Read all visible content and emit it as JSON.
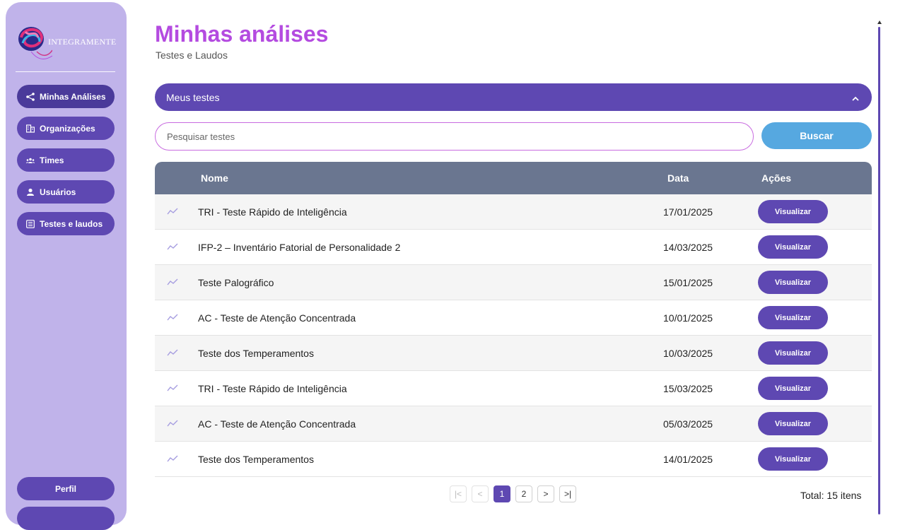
{
  "brand": {
    "logo_text": "INTEGRAMENTE"
  },
  "sidebar": {
    "items": [
      {
        "label": "Minhas Análises",
        "icon": "share-icon",
        "active": true
      },
      {
        "label": "Organizações",
        "icon": "building-icon"
      },
      {
        "label": "Times",
        "icon": "team-icon"
      },
      {
        "label": "Usuários",
        "icon": "user-icon"
      },
      {
        "label": "Testes e laudos",
        "icon": "document-list-icon"
      }
    ],
    "perfil_label": "Perfil"
  },
  "header": {
    "title": "Minhas análises",
    "subtitle": "Testes e Laudos"
  },
  "accordion": {
    "label": "Meus testes",
    "icon": "chevron-up-icon"
  },
  "search": {
    "placeholder": "Pesquisar testes",
    "value": "",
    "button_label": "Buscar"
  },
  "table": {
    "columns": [
      "Nome",
      "Data",
      "Ações"
    ],
    "rows": [
      {
        "name": "TRI - Teste Rápido de Inteligência",
        "date": "17/01/2025",
        "action": "Visualizar"
      },
      {
        "name": "IFP-2 – Inventário Fatorial de Personalidade 2",
        "date": "14/03/2025",
        "action": "Visualizar"
      },
      {
        "name": "Teste Palográfico",
        "date": "15/01/2025",
        "action": "Visualizar"
      },
      {
        "name": "AC - Teste de Atenção Concentrada",
        "date": "10/01/2025",
        "action": "Visualizar"
      },
      {
        "name": "Teste dos Temperamentos",
        "date": "10/03/2025",
        "action": "Visualizar"
      },
      {
        "name": "TRI - Teste Rápido de Inteligência",
        "date": "15/03/2025",
        "action": "Visualizar"
      },
      {
        "name": "AC - Teste de Atenção Concentrada",
        "date": "05/03/2025",
        "action": "Visualizar"
      },
      {
        "name": "Teste dos Temperamentos",
        "date": "14/01/2025",
        "action": "Visualizar"
      }
    ],
    "row_icon": "trend-line-icon"
  },
  "pagination": {
    "first": "|<",
    "prev": "<",
    "pages": [
      "1",
      "2"
    ],
    "current": "1",
    "next": ">",
    "last": ">|",
    "total_label": "Total: 15 itens"
  },
  "colors": {
    "primary": "#5e48b2",
    "sidebar_bg": "#c0b3ea",
    "title": "#b44be0",
    "search_button": "#56a8e0",
    "table_header": "#6a7690"
  }
}
